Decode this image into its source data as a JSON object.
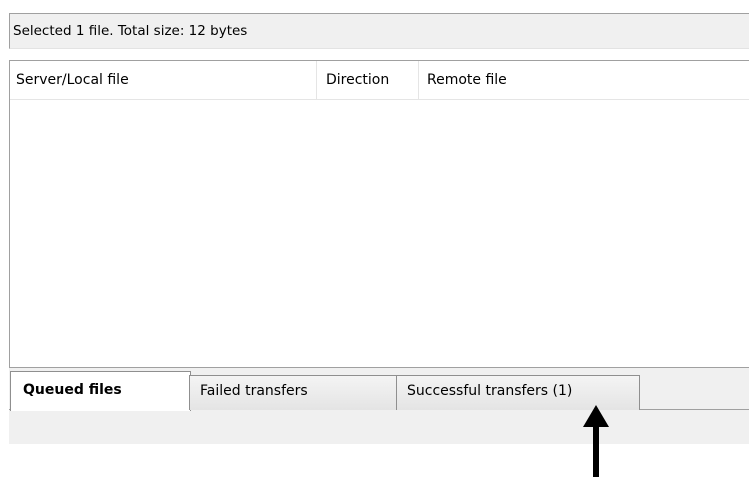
{
  "status": {
    "selection_text": "Selected 1 file. Total size: 12 bytes"
  },
  "queue_list": {
    "columns": [
      "Server/Local file",
      "Direction",
      "Remote file"
    ],
    "rows": []
  },
  "tabs": [
    {
      "label": "Queued files",
      "active": true
    },
    {
      "label": "Failed transfers",
      "active": false
    },
    {
      "label": "Successful transfers (1)",
      "active": false
    }
  ],
  "annotation": {
    "icon": "arrow-up-icon",
    "color": "#000000"
  }
}
